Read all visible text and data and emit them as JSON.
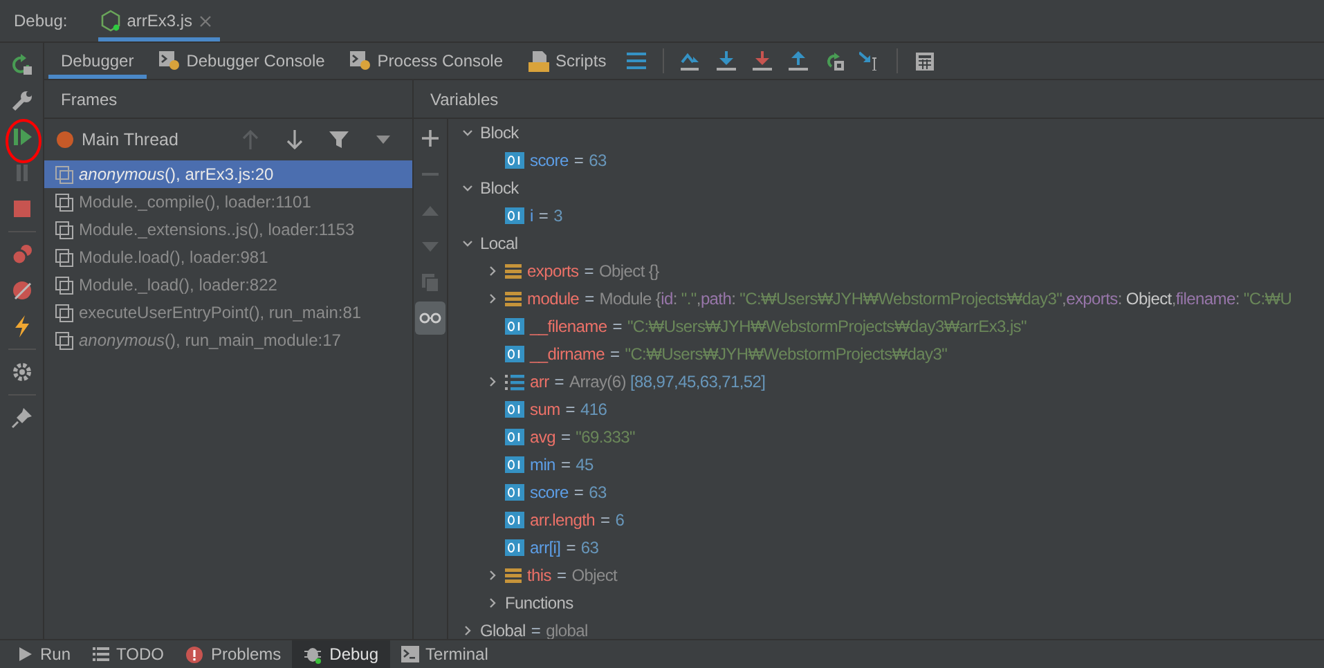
{
  "debug_bar": {
    "label": "Debug:",
    "tab": {
      "label": "arrEx3.js",
      "selected": true
    }
  },
  "tabs": [
    {
      "label": "Debugger",
      "selected": true,
      "kind": "plain"
    },
    {
      "label": "Debugger Console",
      "selected": false,
      "kind": "console"
    },
    {
      "label": "Process Console",
      "selected": false,
      "kind": "console"
    },
    {
      "label": "Scripts",
      "selected": false,
      "kind": "scripts"
    }
  ],
  "frames_panel": {
    "title": "Frames",
    "thread": "Main Thread",
    "frames": [
      {
        "label": "*anonymous*(), arrEx3.js:20",
        "selected": true
      },
      {
        "label": "Module._compile(), loader:1101",
        "selected": false
      },
      {
        "label": "Module._extensions..js(), loader:1153",
        "selected": false
      },
      {
        "label": "Module.load(), loader:981",
        "selected": false
      },
      {
        "label": "Module._load(), loader:822",
        "selected": false
      },
      {
        "label": "executeUserEntryPoint(), run_main:81",
        "selected": false
      },
      {
        "label": "*anonymous*(), run_main_module:17",
        "selected": false
      }
    ]
  },
  "variables_panel": {
    "title": "Variables",
    "tree": [
      {
        "kind": "scope",
        "name": "Block",
        "expanded": true,
        "children": [
          {
            "kind": "primitive",
            "name": "score",
            "color": "#5d9ee6",
            "value": [
              {
                "kind": "op",
                "text": "="
              },
              {
                "kind": "number",
                "text": "63"
              }
            ]
          }
        ]
      },
      {
        "kind": "scope",
        "name": "Block",
        "expanded": true,
        "children": [
          {
            "kind": "primitive",
            "name": "i",
            "color": "#5d9ee6",
            "value": [
              {
                "kind": "op",
                "text": "="
              },
              {
                "kind": "number",
                "text": "3"
              }
            ]
          }
        ]
      },
      {
        "kind": "scope",
        "name": "Local",
        "expanded": true,
        "children": [
          {
            "kind": "object",
            "name": "exports",
            "color": "#ec7168",
            "expanded": false,
            "value": [
              {
                "kind": "op",
                "text": "="
              },
              {
                "kind": "plain",
                "text": "Object {}"
              }
            ]
          },
          {
            "kind": "object",
            "name": "module",
            "color": "#ec7168",
            "expanded": false,
            "value": [
              {
                "kind": "op",
                "text": "="
              },
              {
                "kind": "plain",
                "text": "Module {"
              },
              {
                "kind": "key",
                "text": "id"
              },
              {
                "kind": "plain",
                "text": ": "
              },
              {
                "kind": "string",
                "text": "\".\""
              },
              {
                "kind": "plain",
                "text": ","
              },
              {
                "kind": "key",
                "text": "path"
              },
              {
                "kind": "plain",
                "text": ": "
              },
              {
                "kind": "string",
                "text": "\"C:₩Users₩JYH₩WebstormProjects₩day3\""
              },
              {
                "kind": "plain",
                "text": ","
              },
              {
                "kind": "key",
                "text": "exports"
              },
              {
                "kind": "plain",
                "text": ": "
              },
              {
                "kind": "bright",
                "text": "Object"
              },
              {
                "kind": "plain",
                "text": ","
              },
              {
                "kind": "key",
                "text": "filename"
              },
              {
                "kind": "plain",
                "text": ": "
              },
              {
                "kind": "string",
                "text": "\"C:₩U"
              }
            ]
          },
          {
            "kind": "primitive",
            "name": "__filename",
            "color": "#ec7168",
            "value": [
              {
                "kind": "op",
                "text": "="
              },
              {
                "kind": "string",
                "text": "\"C:₩Users₩JYH₩WebstormProjects₩day3₩arrEx3.js\""
              }
            ]
          },
          {
            "kind": "primitive",
            "name": "__dirname",
            "color": "#ec7168",
            "value": [
              {
                "kind": "op",
                "text": "="
              },
              {
                "kind": "string",
                "text": "\"C:₩Users₩JYH₩WebstormProjects₩day3\""
              }
            ]
          },
          {
            "kind": "array",
            "name": "arr",
            "color": "#ec7168",
            "expanded": false,
            "value": [
              {
                "kind": "op",
                "text": "="
              },
              {
                "kind": "plain",
                "text": "Array(6) "
              },
              {
                "kind": "number",
                "text": "[88,97,45,63,71,52]"
              }
            ]
          },
          {
            "kind": "primitive",
            "name": "sum",
            "color": "#ec7168",
            "value": [
              {
                "kind": "op",
                "text": "="
              },
              {
                "kind": "number",
                "text": "416"
              }
            ]
          },
          {
            "kind": "primitive",
            "name": "avg",
            "color": "#ec7168",
            "value": [
              {
                "kind": "op",
                "text": "="
              },
              {
                "kind": "string",
                "text": "\"69.333\""
              }
            ]
          },
          {
            "kind": "primitive",
            "name": "min",
            "color": "#5d9ee6",
            "value": [
              {
                "kind": "op",
                "text": "="
              },
              {
                "kind": "number",
                "text": "45"
              }
            ]
          },
          {
            "kind": "primitive",
            "name": "score",
            "color": "#5d9ee6",
            "value": [
              {
                "kind": "op",
                "text": "="
              },
              {
                "kind": "number",
                "text": "63"
              }
            ]
          },
          {
            "kind": "primitive",
            "name": "arr.length",
            "color": "#ec7168",
            "value": [
              {
                "kind": "op",
                "text": "="
              },
              {
                "kind": "number",
                "text": "6"
              }
            ]
          },
          {
            "kind": "primitive",
            "name": "arr[i]",
            "color": "#5d9ee6",
            "value": [
              {
                "kind": "op",
                "text": "="
              },
              {
                "kind": "number",
                "text": "63"
              }
            ]
          },
          {
            "kind": "object",
            "name": "this",
            "color": "#ec7168",
            "expanded": false,
            "value": [
              {
                "kind": "op",
                "text": "="
              },
              {
                "kind": "plain",
                "text": "Object"
              }
            ]
          },
          {
            "kind": "scope",
            "name": "Functions",
            "expanded": false
          }
        ]
      },
      {
        "kind": "scope",
        "name": "Global",
        "expanded": false,
        "value": [
          {
            "kind": "op",
            "text": "="
          },
          {
            "kind": "plain",
            "text": "global"
          }
        ]
      }
    ]
  },
  "bottom_tabs": [
    {
      "label": "Run",
      "selected": false,
      "kind": "run"
    },
    {
      "label": "TODO",
      "selected": false,
      "kind": "todo"
    },
    {
      "label": "Problems",
      "selected": false,
      "kind": "problems"
    },
    {
      "label": "Debug",
      "selected": true,
      "kind": "debug"
    },
    {
      "label": "Terminal",
      "selected": false,
      "kind": "terminal"
    }
  ]
}
